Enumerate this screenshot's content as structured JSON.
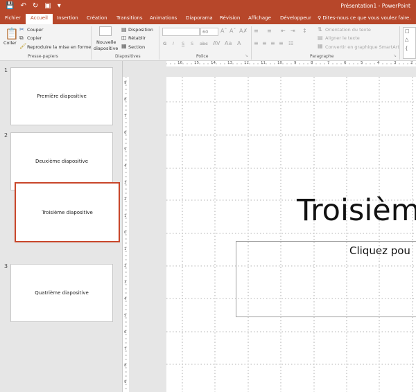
{
  "window": {
    "title": "Présentation1 - PowerPoint"
  },
  "qat": {
    "save_icon": "save-icon",
    "undo_icon": "undo-icon",
    "redo_icon": "redo-icon",
    "start_icon": "start-slideshow-icon",
    "more_icon": "customize-qat-icon"
  },
  "tabs": [
    {
      "label": "Fichier"
    },
    {
      "label": "Accueil"
    },
    {
      "label": "Insertion"
    },
    {
      "label": "Création"
    },
    {
      "label": "Transitions"
    },
    {
      "label": "Animations"
    },
    {
      "label": "Diaporama"
    },
    {
      "label": "Révision"
    },
    {
      "label": "Affichage"
    },
    {
      "label": "Développeur"
    }
  ],
  "tellme": "Dites-nous ce que vous voulez faire.",
  "ribbon": {
    "clipboard": {
      "paste": "Coller",
      "cut": "Couper",
      "copy": "Copier",
      "painter": "Reproduire la mise en forme",
      "label": "Presse-papiers"
    },
    "slides": {
      "new_slide_1": "Nouvelle",
      "new_slide_2": "diapositive",
      "layout": "Disposition",
      "reset": "Rétablir",
      "section": "Section",
      "label": "Diapositives"
    },
    "font": {
      "size": "60",
      "bold": "G",
      "italic": "I",
      "underline": "S",
      "shadow": "S",
      "strike": "abc",
      "label": "Police"
    },
    "paragraph": {
      "direction": "Orientation du texte",
      "align": "Aligner le texte",
      "smartart": "Convertir en graphique SmartArt",
      "label": "Paragraphe"
    }
  },
  "slides": [
    {
      "number": "1",
      "title": "Première diapositive"
    },
    {
      "number": "2",
      "title": "Deuxième diapositive"
    },
    {
      "number": "",
      "title": "Troisième diapositive"
    },
    {
      "number": "3",
      "title": "Quatrième diapositive"
    }
  ],
  "hruler_ticks": [
    "16",
    "15",
    "14",
    "13",
    "12",
    "11",
    "10",
    "9",
    "8",
    "7",
    "6",
    "5",
    "4",
    "3",
    "2"
  ],
  "vruler_ticks": [
    "9",
    "8",
    "7",
    "6",
    "5",
    "4",
    "3",
    "2",
    "1",
    "0",
    "1",
    "2",
    "3",
    "4",
    "5",
    "6",
    "7",
    "8",
    "9"
  ],
  "editor": {
    "title": "Troisièm",
    "subtitle": "Cliquez pou"
  },
  "colors": {
    "accent": "#b7472a",
    "selection": "#c8462a"
  }
}
